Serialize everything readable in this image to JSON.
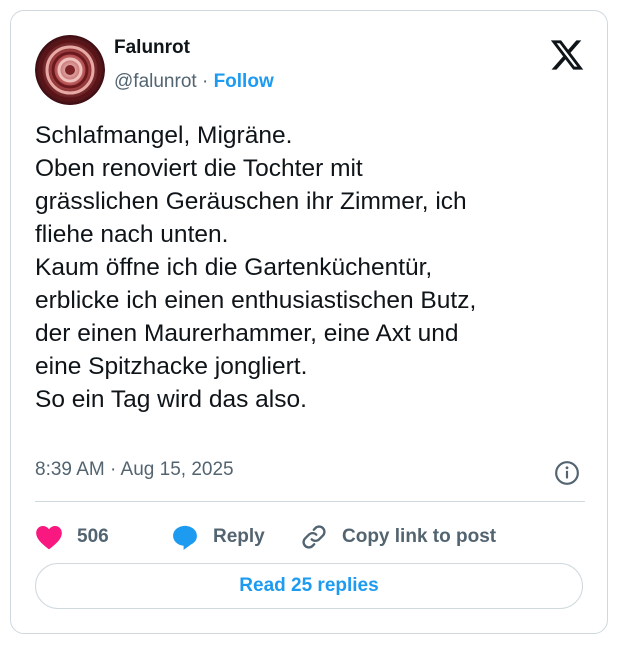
{
  "author": {
    "name": "Falunrot",
    "handle": "@falunrot",
    "separator": "·",
    "follow_label": "Follow",
    "avatar_icon": "spiral-avatar"
  },
  "platform_icon": "x-logo-icon",
  "tweet": {
    "lines": [
      "Schlafmangel, Migräne.",
      "Oben renoviert die Tochter mit",
      "grässlichen Geräuschen ihr Zimmer, ich",
      "fliehe nach unten.",
      "Kaum öffne ich die Gartenküchentür,",
      "erblicke ich einen enthusiastischen Butz,",
      "der einen Maurerhammer, eine Axt und",
      "eine Spitzhacke jongliert.",
      "So ein Tag wird das also."
    ],
    "timestamp": "8:39 AM · Aug 15, 2025"
  },
  "actions": {
    "like_count": "506",
    "reply_label": "Reply",
    "copy_link_label": "Copy link to post"
  },
  "read_replies_label": "Read 25 replies",
  "colors": {
    "accent": "#1d9bf0",
    "like": "#f91880",
    "text": "#0f1419",
    "muted": "#536471",
    "border": "#cfd9de"
  }
}
